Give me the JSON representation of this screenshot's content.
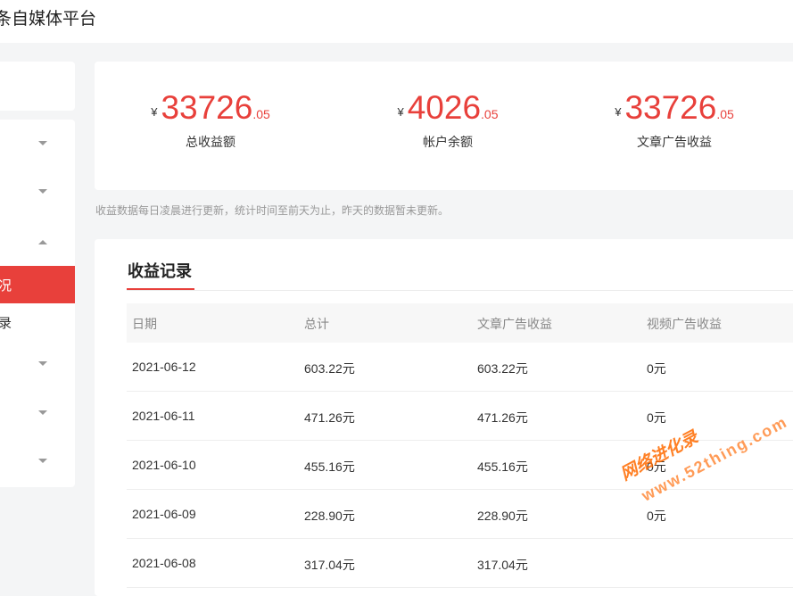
{
  "header": {
    "brand": "条自媒体平台"
  },
  "sidebar": {
    "active_label": "况",
    "sub_label": "录"
  },
  "summary": {
    "currency": "¥",
    "stats": [
      {
        "int": "33726",
        "dec": ".05",
        "label": "总收益额"
      },
      {
        "int": "4026",
        "dec": ".05",
        "label": "帐户余额"
      },
      {
        "int": "33726",
        "dec": ".05",
        "label": "文章广告收益"
      }
    ]
  },
  "note": "收益数据每日凌晨进行更新，统计时间至前天为止，昨天的数据暂未更新。",
  "records": {
    "title": "收益记录",
    "columns": [
      "日期",
      "总计",
      "文章广告收益",
      "视频广告收益"
    ],
    "rows": [
      [
        "2021-06-12",
        "603.22元",
        "603.22元",
        "0元"
      ],
      [
        "2021-06-11",
        "471.26元",
        "471.26元",
        "0元"
      ],
      [
        "2021-06-10",
        "455.16元",
        "455.16元",
        "0元"
      ],
      [
        "2021-06-09",
        "228.90元",
        "228.90元",
        "0元"
      ],
      [
        "2021-06-08",
        "317.04元",
        "317.04元",
        ""
      ]
    ]
  },
  "watermark": {
    "text1": "网络进化录",
    "text2": "www.52thing.com"
  }
}
